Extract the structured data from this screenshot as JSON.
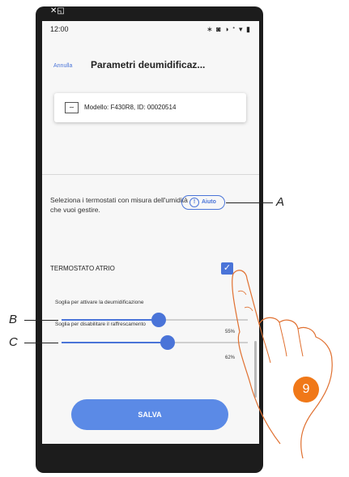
{
  "statusbar": {
    "time": "12:00",
    "right_icons": "∗ ◙ ◑ ᐩ ▾ ▮"
  },
  "corner_icons": "✕◱",
  "header": {
    "cancel": "Annulla",
    "title": "Parametri deumidificaz..."
  },
  "device": {
    "icon": "thermostat-icon",
    "model": "Modello: F430R8, ID: 00020514"
  },
  "intro": {
    "text": "Seleziona i termostati con misura dell'umidità che vuoi gestire.",
    "help": "Aiuto"
  },
  "thermostat": {
    "name": "TERMOSTATO ATRIO",
    "checked": true
  },
  "sliders": [
    {
      "label": "Soglia per attivare la deumidificazione",
      "value": 55,
      "display": "55%"
    },
    {
      "label": "Soglia per disabilitare il raffrescamento",
      "value": 62,
      "display": "62%"
    }
  ],
  "save_label": "SALVA",
  "callouts": {
    "a": "A",
    "b": "B",
    "c": "C"
  },
  "step": "9",
  "colors": {
    "accent": "#4a74d8",
    "button": "#5b8ae6",
    "step": "#f07818"
  }
}
